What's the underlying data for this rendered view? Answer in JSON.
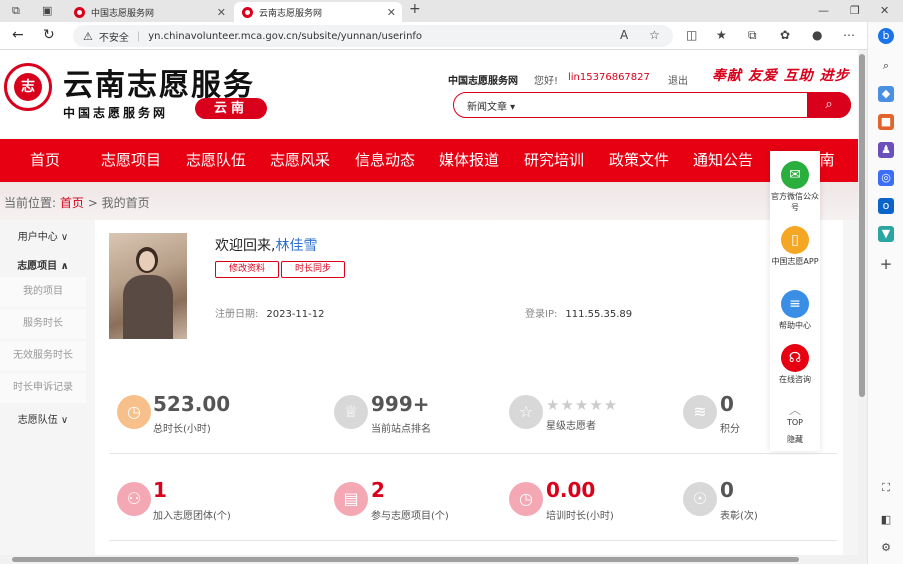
{
  "browser": {
    "tabs": [
      {
        "title": "中国志愿服务网",
        "active": false
      },
      {
        "title": "云南志愿服务网",
        "active": true
      }
    ],
    "security_label": "不安全",
    "url": "yn.chinavolunteer.mca.gov.cn/subsite/yunnan/userinfo"
  },
  "header": {
    "logo_title": "云南志愿服务",
    "logo_subtitle": "中国志愿服务网",
    "region": "云南",
    "site_link": "中国志愿服务网",
    "greeting": "您好!",
    "username": "lin15376867827",
    "logout": "退出",
    "slogan": "奉献 友爱 互助 进步",
    "search_category": "新闻文章 ▾"
  },
  "nav": [
    "首页",
    "志愿项目",
    "志愿队伍",
    "志愿风采",
    "信息动态",
    "媒体报道",
    "研究培训",
    "政策文件",
    "通知公告",
    "南"
  ],
  "breadcrumb": {
    "label": "当前位置:",
    "home": "首页",
    "sep": ">",
    "current": "我的首页"
  },
  "sidebar": {
    "user_center": "用户中心 ∨",
    "projects": "志愿项目 ∧",
    "my_projects": "我的项目",
    "service_hours": "服务时长",
    "invalid_hours": "无效服务时长",
    "hour_appeal": "时长申诉记录",
    "teams": "志愿队伍 ∨"
  },
  "profile": {
    "welcome": "欢迎回来,",
    "name": "林佳雪",
    "edit_btn": "修改资料",
    "sync_btn": "时长同步",
    "reg_label": "注册日期:",
    "reg_date": "2023-11-12",
    "ip_label": "登录IP:",
    "ip": "111.55.35.89"
  },
  "stats": [
    {
      "value": "523.00",
      "label": "总时长(小时)"
    },
    {
      "value": "999+",
      "label": "当前站点排名"
    },
    {
      "value": "",
      "label": "星级志愿者"
    },
    {
      "value": "0",
      "label": "积分"
    },
    {
      "value": "1",
      "label": "加入志愿团体(个)"
    },
    {
      "value": "2",
      "label": "参与志愿项目(个)"
    },
    {
      "value": "0.00",
      "label": "培训时长(小时)"
    },
    {
      "value": "0",
      "label": "表彰(次)"
    }
  ],
  "float_bar": {
    "wechat": "官方微信公众号",
    "app": "中国志愿APP",
    "help": "帮助中心",
    "consult": "在线咨询",
    "top": "TOP",
    "hide": "隐藏"
  },
  "colors": {
    "brand_red": "#e60012",
    "link_blue": "#2f6fce"
  }
}
